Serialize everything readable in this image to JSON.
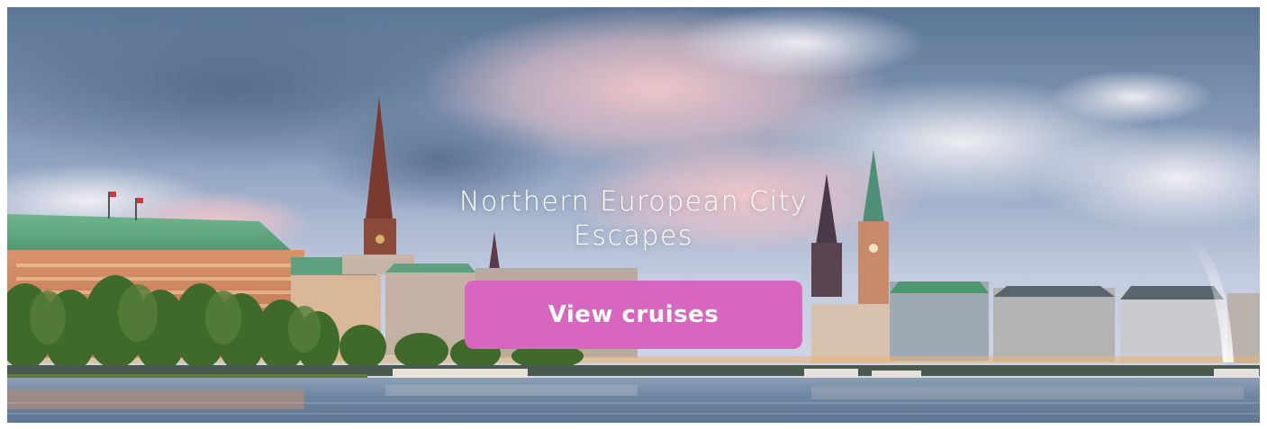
{
  "hero": {
    "image": "hamburg-binnenalster-skyline",
    "title": "Northern European City Escapes",
    "cta_label": "View cruises"
  },
  "colors": {
    "cta_background": "#d865c0",
    "cta_text": "#ffffff",
    "title_text": "#ffffff"
  }
}
